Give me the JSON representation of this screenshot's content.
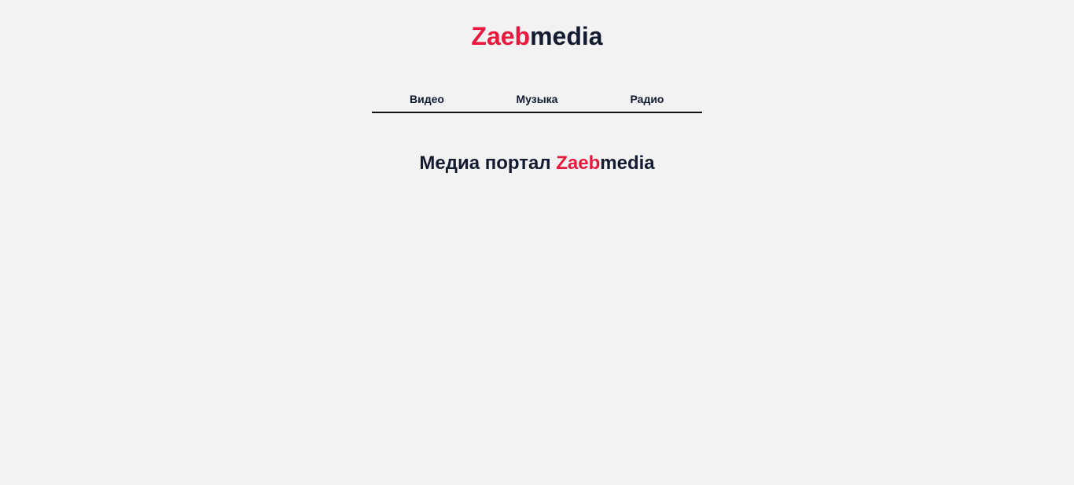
{
  "header": {
    "logo_accent": "Zaeb",
    "logo_rest": "media"
  },
  "nav": {
    "items": [
      {
        "label": "Видео"
      },
      {
        "label": "Музыка"
      },
      {
        "label": "Радио"
      }
    ]
  },
  "main": {
    "title_prefix": "Медиа портал ",
    "title_accent": "Zaeb",
    "title_rest": "media"
  },
  "colors": {
    "background": "#f2f2f2",
    "accent": "#e8193c",
    "text_dark": "#131b31",
    "nav_underline": "#111111"
  }
}
